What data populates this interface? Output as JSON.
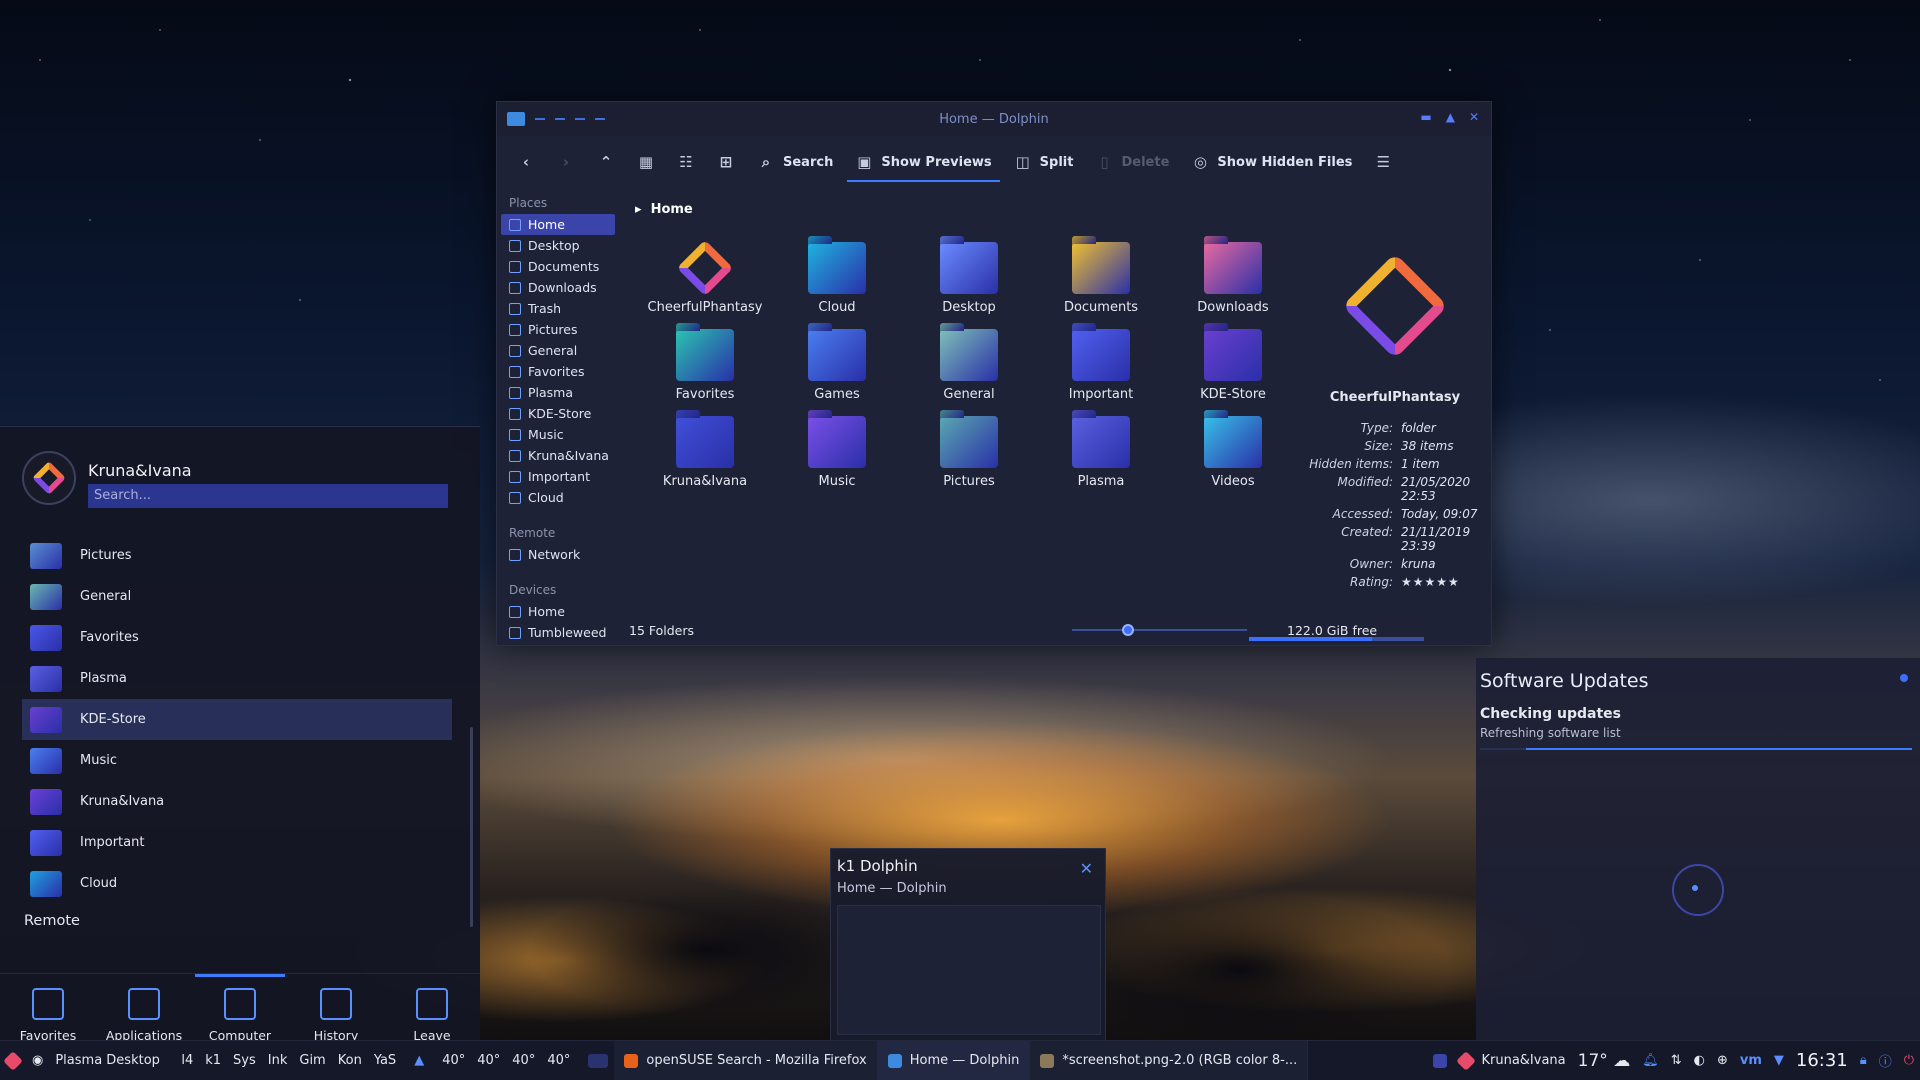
{
  "dolphin": {
    "title": "Home — Dolphin",
    "toolbar": {
      "search": "Search",
      "show_previews": "Show Previews",
      "split": "Split",
      "delete": "Delete",
      "show_hidden": "Show Hidden Files"
    },
    "places_header": "Places",
    "places": [
      "Home",
      "Desktop",
      "Documents",
      "Downloads",
      "Trash",
      "Pictures",
      "General",
      "Favorites",
      "Plasma",
      "KDE-Store",
      "Music",
      "Kruna&Ivana",
      "Important",
      "Cloud"
    ],
    "remote_header": "Remote",
    "remote": [
      "Network"
    ],
    "devices_header": "Devices",
    "devices": [
      "Home",
      "Tumbleweed"
    ],
    "breadcrumb": "Home",
    "files": [
      {
        "name": "CheerfulPhantasy",
        "color": "logo"
      },
      {
        "name": "Cloud",
        "color": "#1fb3e0"
      },
      {
        "name": "Desktop",
        "color": "#6b8cff"
      },
      {
        "name": "Documents",
        "color": "#f0c030"
      },
      {
        "name": "Downloads",
        "color": "#e86aa0"
      },
      {
        "name": "Favorites",
        "color": "#2bc4b0"
      },
      {
        "name": "Games",
        "color": "#4a7ff0"
      },
      {
        "name": "General",
        "color": "#7fc0b8"
      },
      {
        "name": "Important",
        "color": "#5060f0"
      },
      {
        "name": "KDE-Store",
        "color": "#6a3fd0"
      },
      {
        "name": "Kruna&Ivana",
        "color": "#4050d8"
      },
      {
        "name": "Music",
        "color": "#7a50e8"
      },
      {
        "name": "Pictures",
        "color": "#5aa8b0"
      },
      {
        "name": "Plasma",
        "color": "#5a60e0"
      },
      {
        "name": "Videos",
        "color": "#38c0e8"
      }
    ],
    "info": {
      "name": "CheerfulPhantasy",
      "rows": [
        [
          "Type:",
          "folder"
        ],
        [
          "Size:",
          "38 items"
        ],
        [
          "Hidden items:",
          "1 item"
        ],
        [
          "Modified:",
          "21/05/2020 22:53"
        ],
        [
          "Accessed:",
          "Today, 09:07"
        ],
        [
          "Created:",
          "21/11/2019 23:39"
        ],
        [
          "Owner:",
          "kruna"
        ]
      ],
      "rating_label": "Rating:",
      "rating": "★★★★★"
    },
    "status": {
      "folders": "15 Folders",
      "free": "122.0 GiB free",
      "zoom_level": 0.3,
      "disk_used": 0.7
    }
  },
  "launcher": {
    "user": "Kruna&Ivana",
    "search_placeholder": "Search...",
    "items": [
      {
        "label": "Pictures",
        "color": "#5a8fd0"
      },
      {
        "label": "General",
        "color": "#6ab8b0"
      },
      {
        "label": "Favorites",
        "color": "#4a58e8"
      },
      {
        "label": "Plasma",
        "color": "#5a60e0"
      },
      {
        "label": "KDE-Store",
        "color": "#6a3fd0"
      },
      {
        "label": "Music",
        "color": "#4a7ff0"
      },
      {
        "label": "Kruna&Ivana",
        "color": "#6a40d8"
      },
      {
        "label": "Important",
        "color": "#5060f0"
      },
      {
        "label": "Cloud",
        "color": "#1fa0e0"
      }
    ],
    "remote_label": "Remote",
    "tabs": [
      "Favorites",
      "Applications",
      "Computer",
      "History",
      "Leave"
    ]
  },
  "updates": {
    "title": "Software Updates",
    "status": "Checking updates",
    "detail": "Refreshing software list"
  },
  "thumbnail": {
    "title": "k1 Dolphin",
    "subtitle": "Home — Dolphin"
  },
  "taskbar": {
    "activity": "Plasma Desktop",
    "pager": [
      "l4",
      "k1",
      "Sys",
      "Ink",
      "Gim",
      "Kon",
      "YaS"
    ],
    "temps": [
      "40°",
      "40°",
      "40°",
      "40°"
    ],
    "tasks": [
      "openSUSE Search - Mozilla Firefox",
      "Home — Dolphin",
      "*screenshot.png-2.0 (RGB color 8-..."
    ],
    "user": "Kruna&Ivana",
    "weather": "17°",
    "time": "16:31"
  }
}
